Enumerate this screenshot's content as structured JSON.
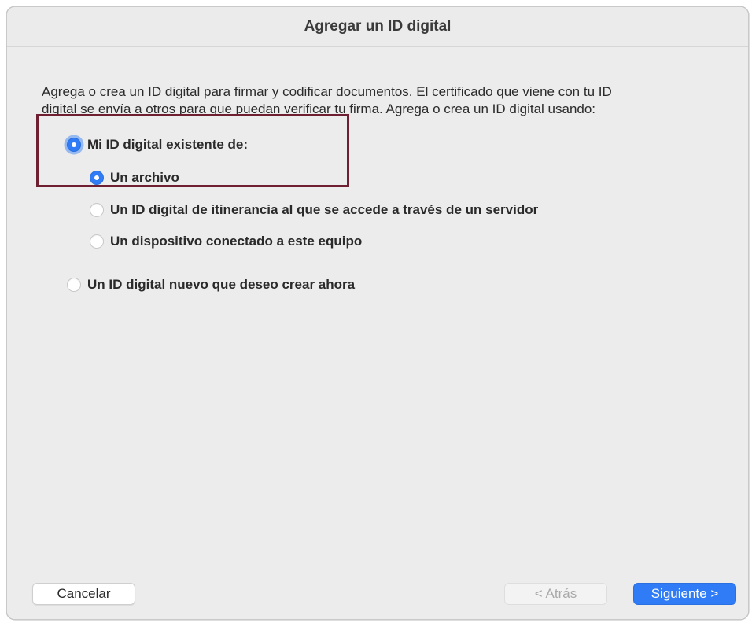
{
  "window": {
    "title": "Agregar un ID digital"
  },
  "description": {
    "line1": "Agrega o crea un ID digital para firmar y codificar documentos. El certificado que viene con tu ID",
    "line2": "digital se envía a otros para que puedan verificar tu firma. Agrega o crea un ID digital usando:"
  },
  "options": {
    "existing": {
      "label": "Mi ID digital existente de:",
      "selected": true
    },
    "file": {
      "label": "Un archivo",
      "selected": true
    },
    "roaming": {
      "label": "Un ID digital de itinerancia al que se accede a través de un servidor",
      "selected": false
    },
    "device": {
      "label": "Un dispositivo conectado a este equipo",
      "selected": false
    },
    "new": {
      "label": "Un ID digital nuevo que deseo crear ahora",
      "selected": false
    }
  },
  "buttons": {
    "cancel": "Cancelar",
    "back": "< Atrás",
    "next": "Siguiente >"
  },
  "colors": {
    "accent": "#2f7cf6",
    "highlight_border": "#6e1f32",
    "window_bg": "#ececec"
  }
}
